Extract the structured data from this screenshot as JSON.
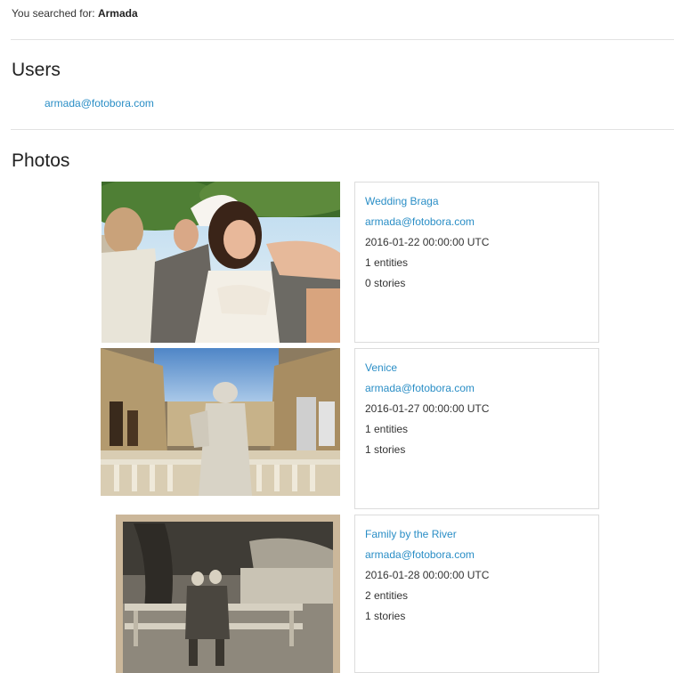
{
  "search": {
    "prefix": "You searched for:",
    "term": "Armada"
  },
  "users": {
    "heading": "Users",
    "items": [
      "armada@fotobora.com"
    ]
  },
  "photos": {
    "heading": "Photos",
    "items": [
      {
        "title": "Wedding Braga",
        "owner": "armada@fotobora.com",
        "date": "2016-01-22 00:00:00 UTC",
        "entities": "1 entities",
        "stories": "0 stories"
      },
      {
        "title": "Venice",
        "owner": "armada@fotobora.com",
        "date": "2016-01-27 00:00:00 UTC",
        "entities": "1 entities",
        "stories": "1 stories"
      },
      {
        "title": "Family by the River",
        "owner": "armada@fotobora.com",
        "date": "2016-01-28 00:00:00 UTC",
        "entities": "2 entities",
        "stories": "1 stories"
      }
    ]
  },
  "colors": {
    "link": "#2a8ec6",
    "divider": "#e2e2e2",
    "card_border": "#dcdcdc"
  }
}
